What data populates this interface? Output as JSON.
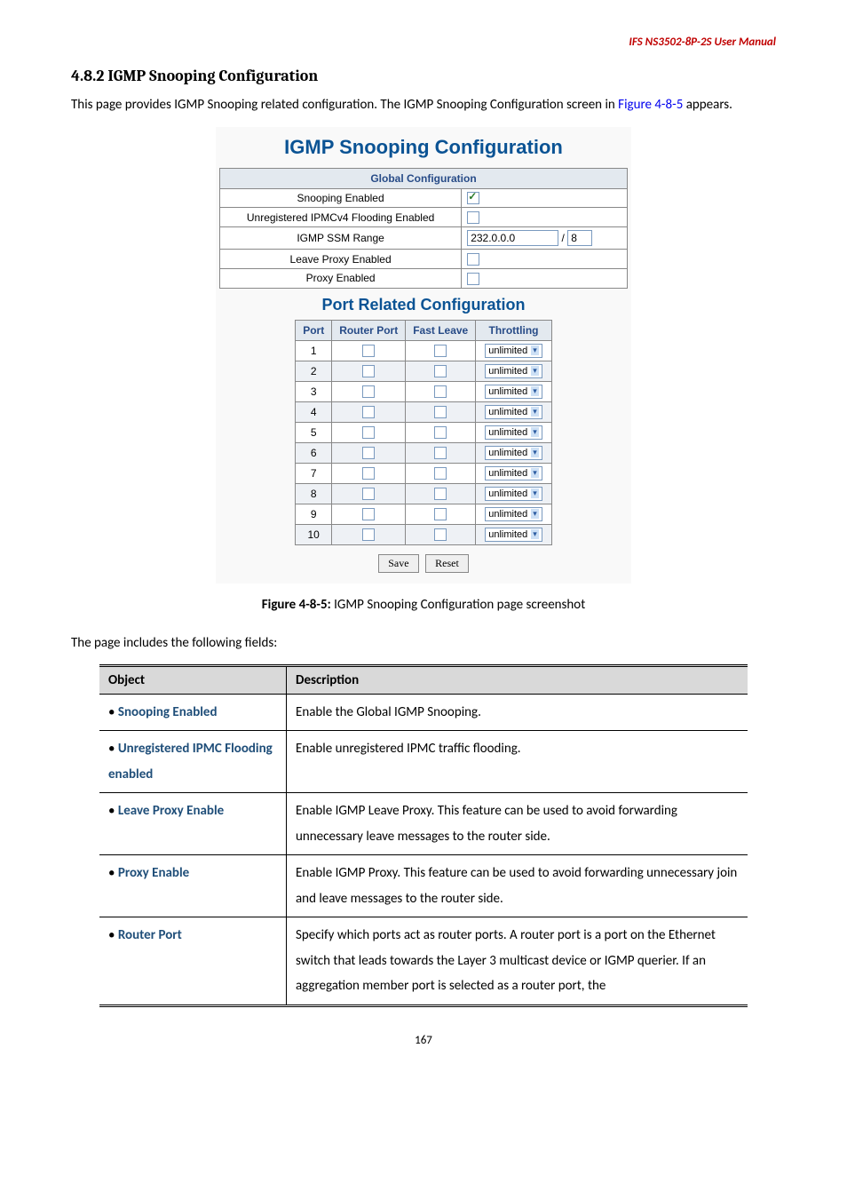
{
  "header": {
    "product": "IFS NS3502-8P-2S  User  Manual"
  },
  "section": {
    "number": "4.8.2",
    "title": "IGMP Snooping Configuration",
    "intro_prefix": "This page provides IGMP Snooping related configuration. The IGMP Snooping Configuration screen in ",
    "intro_link": "Figure 4-8-5",
    "intro_suffix": " appears."
  },
  "panel": {
    "title": "IGMP Snooping Configuration",
    "global_header": "Global Configuration",
    "rows": {
      "snooping": {
        "label": "Snooping Enabled",
        "checked": true
      },
      "flooding": {
        "label": "Unregistered IPMCv4 Flooding Enabled",
        "checked": false
      },
      "ssm": {
        "label": "IGMP SSM Range",
        "ip": "232.0.0.0",
        "prefix": "8"
      },
      "leave_proxy": {
        "label": "Leave Proxy Enabled",
        "checked": false
      },
      "proxy": {
        "label": "Proxy Enabled",
        "checked": false
      }
    },
    "port_title": "Port Related Configuration",
    "port_headers": {
      "port": "Port",
      "router": "Router Port",
      "fast": "Fast Leave",
      "throttling": "Throttling"
    },
    "ports": [
      {
        "n": "1",
        "throttling": "unlimited"
      },
      {
        "n": "2",
        "throttling": "unlimited"
      },
      {
        "n": "3",
        "throttling": "unlimited"
      },
      {
        "n": "4",
        "throttling": "unlimited"
      },
      {
        "n": "5",
        "throttling": "unlimited"
      },
      {
        "n": "6",
        "throttling": "unlimited"
      },
      {
        "n": "7",
        "throttling": "unlimited"
      },
      {
        "n": "8",
        "throttling": "unlimited"
      },
      {
        "n": "9",
        "throttling": "unlimited"
      },
      {
        "n": "10",
        "throttling": "unlimited"
      }
    ],
    "buttons": {
      "save": "Save",
      "reset": "Reset"
    }
  },
  "figure_caption": {
    "label": "Figure 4-8-5:",
    "text": " IGMP Snooping Configuration page screenshot"
  },
  "fields_intro": "The page includes the following fields:",
  "table": {
    "h1": "Object",
    "h2": "Description",
    "rows": [
      {
        "obj": "Snooping Enabled",
        "desc": "Enable the Global IGMP Snooping."
      },
      {
        "obj": "Unregistered IPMC Flooding enabled",
        "desc": "Enable unregistered IPMC traffic flooding."
      },
      {
        "obj": "Leave Proxy Enable",
        "desc": "Enable IGMP Leave Proxy. This feature can be used to avoid forwarding unnecessary leave messages to the router side."
      },
      {
        "obj": "Proxy Enable",
        "desc": "Enable IGMP Proxy. This feature can be used to avoid forwarding unnecessary join and leave messages to the router side."
      },
      {
        "obj": "Router Port",
        "desc": "Specify which ports act as router ports. A router port is a port on the Ethernet switch that leads towards the Layer 3 multicast device or IGMP querier.\nIf an aggregation member port is selected as a router port, the"
      }
    ]
  },
  "page_num": "167"
}
